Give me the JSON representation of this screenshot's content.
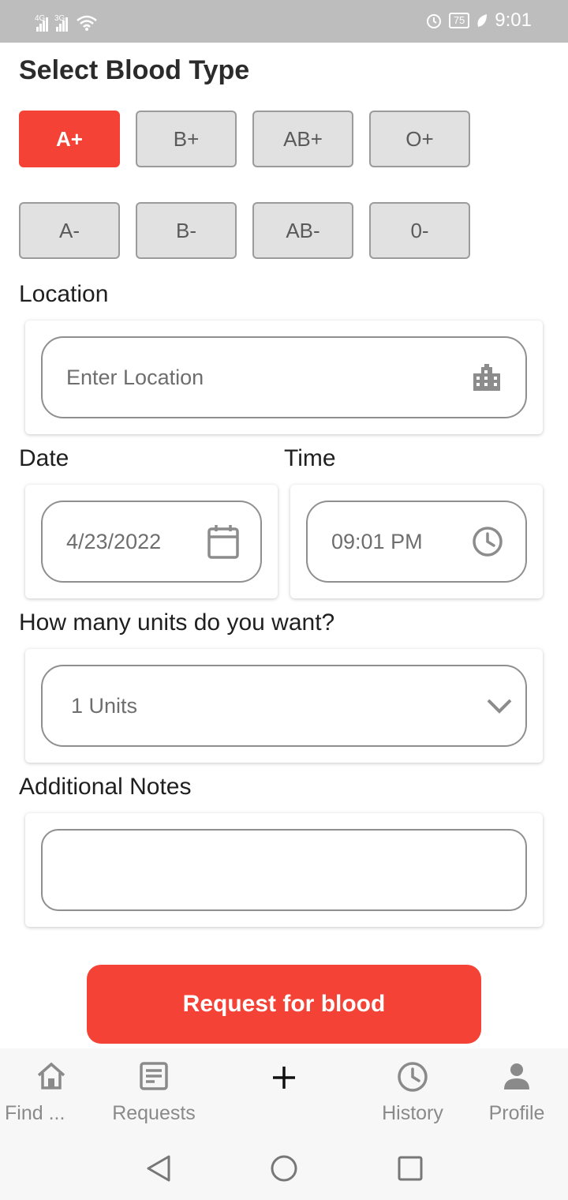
{
  "status_bar": {
    "network_1": "4G",
    "network_2": "3G",
    "battery": "75",
    "time": "9:01",
    "icons": [
      "signal-icon",
      "signal-icon",
      "wifi-icon",
      "alarm-icon",
      "battery-icon",
      "leaf-icon"
    ]
  },
  "page": {
    "heading": "Select Blood Type"
  },
  "blood_types": {
    "row1": [
      "A+",
      "B+",
      "AB+",
      "O+"
    ],
    "row2": [
      "A-",
      "B-",
      "AB-",
      "0-"
    ],
    "selected": "A+"
  },
  "location": {
    "label": "Location",
    "placeholder": "Enter Location",
    "icon": "city-icon"
  },
  "date": {
    "label": "Date",
    "value": "4/23/2022",
    "icon": "calendar-icon"
  },
  "time": {
    "label": "Time",
    "value": "09:01 PM",
    "icon": "clock-icon"
  },
  "units": {
    "label": "How many units do you want?",
    "value": "1 Units",
    "icon": "chevron-down-icon"
  },
  "notes": {
    "label": "Additional Notes",
    "value": ""
  },
  "request_button": {
    "label": "Request for blood"
  },
  "bottom_nav": [
    {
      "label": "Find ...",
      "icon": "home-icon"
    },
    {
      "label": "Requests",
      "icon": "requests-icon"
    },
    {
      "label": "",
      "icon": "plus-icon"
    },
    {
      "label": "History",
      "icon": "history-icon"
    },
    {
      "label": "Profile",
      "icon": "person-icon"
    }
  ],
  "system_nav": [
    "back-icon",
    "home-circle-icon",
    "recents-icon"
  ],
  "colors": {
    "accent": "#f44336",
    "unselected_bg": "#e1e1e1",
    "border": "#8f8f8f"
  }
}
